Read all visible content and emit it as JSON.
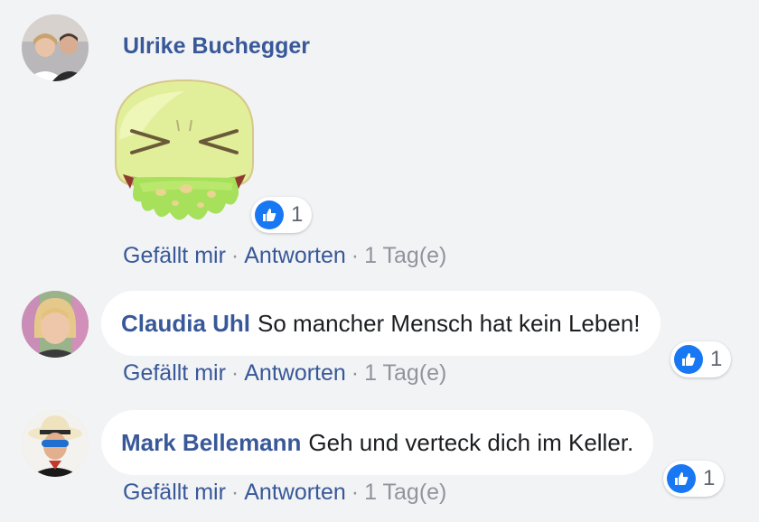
{
  "colors": {
    "link": "#385898",
    "meta": "#90949c",
    "like_blue": "#1877f2",
    "background": "#f2f3f5"
  },
  "comments": [
    {
      "author": "Ulrike Buchegger",
      "text": "",
      "sticker": "vomiting-face-sticker",
      "reactions": {
        "icon": "thumbs-up-icon",
        "count": "1"
      },
      "actions": {
        "like": "Gefällt mir",
        "reply": "Antworten",
        "time": "1 Tag(e)"
      }
    },
    {
      "author": "Claudia Uhl",
      "text": "So mancher Mensch hat kein Leben!",
      "reactions": {
        "icon": "thumbs-up-icon",
        "count": "1"
      },
      "actions": {
        "like": "Gefällt mir",
        "reply": "Antworten",
        "time": "1 Tag(e)"
      }
    },
    {
      "author": "Mark Bellemann",
      "text": "Geh und verteck dich im Keller.",
      "reactions": {
        "icon": "thumbs-up-icon",
        "count": "1"
      },
      "actions": {
        "like": "Gefällt mir",
        "reply": "Antworten",
        "time": "1 Tag(e)"
      }
    }
  ]
}
